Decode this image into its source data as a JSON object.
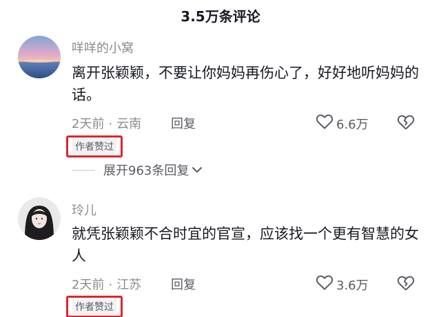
{
  "header": {
    "title": "3.5万条评论"
  },
  "comments": [
    {
      "username": "咩咩的小窝",
      "text": "离开张颖颖，不要让你妈妈再伤心了，好好地听妈妈的话。",
      "time": "2天前",
      "dot": "·",
      "location": "云南",
      "reply_label": "回复",
      "likes": "6.6万",
      "badge": "作者赞过",
      "expand_label": "展开963条回复"
    },
    {
      "username": "玲儿",
      "text": "就凭张颖颖不合时宜的官宣，应该找一个更有智慧的女人",
      "time": "2天前",
      "dot": "·",
      "location": "江苏",
      "reply_label": "回复",
      "likes": "3.6万",
      "badge": "作者赞过"
    }
  ],
  "icons": {
    "like": "heart-outline-icon",
    "dislike": "broken-heart-icon",
    "expand": "chevron-down-icon"
  },
  "colors": {
    "highlight_border": "#e0242b",
    "secondary_text": "#8a8b91",
    "primary_text": "#161823"
  }
}
